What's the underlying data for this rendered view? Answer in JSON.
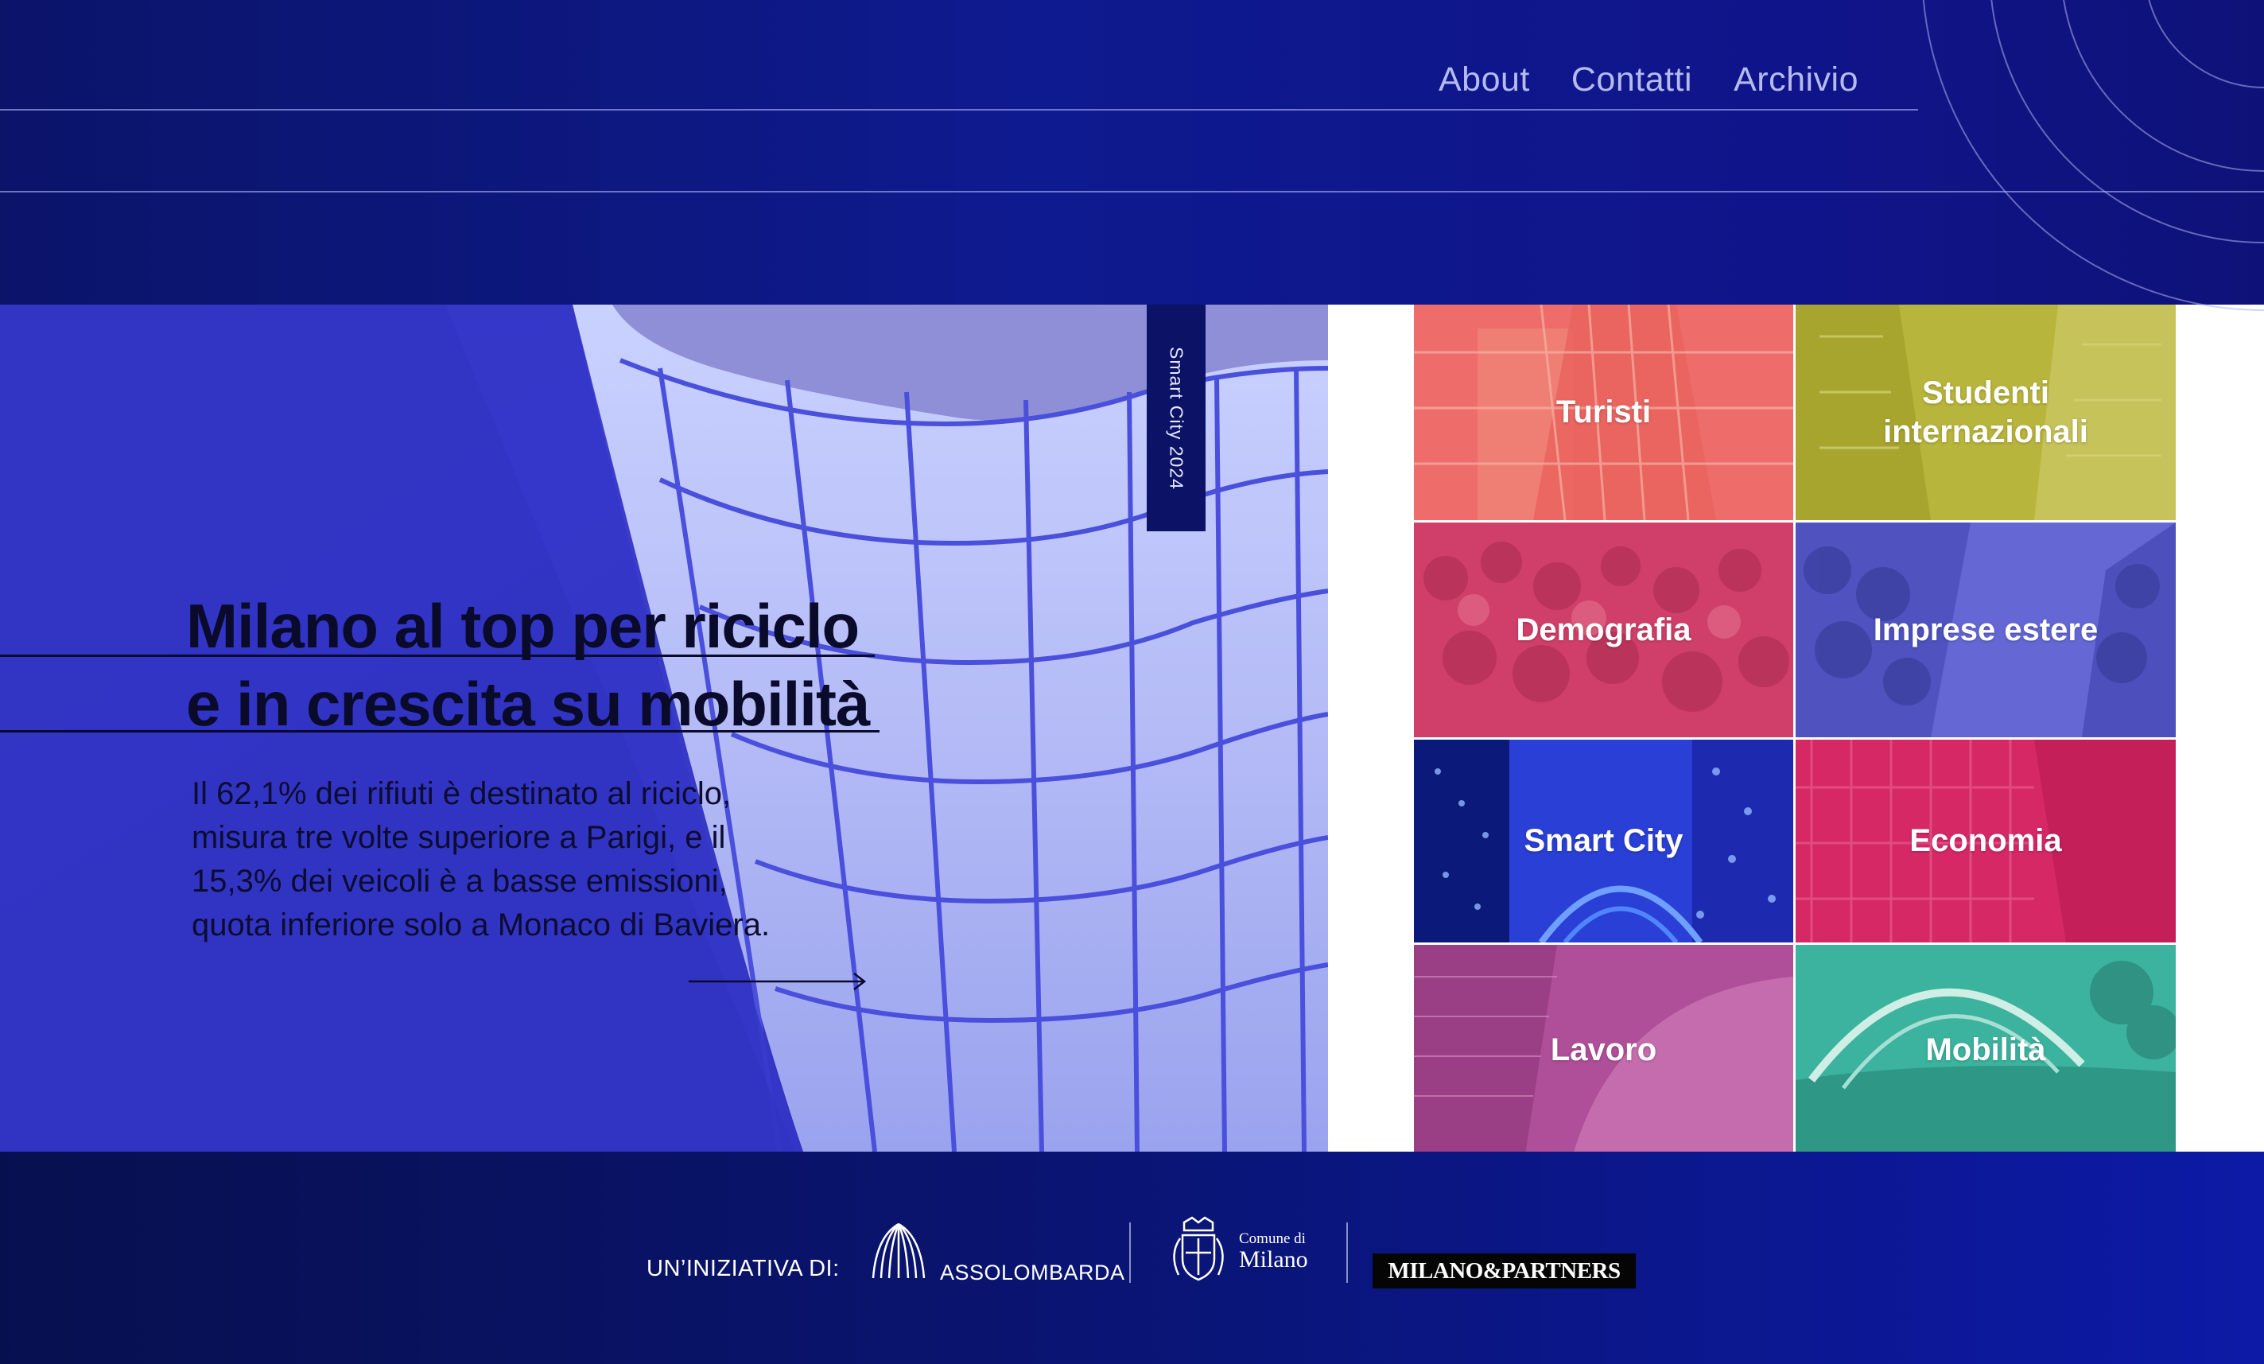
{
  "nav": {
    "items": [
      "About",
      "Contatti",
      "Archivio"
    ]
  },
  "hero": {
    "tag": "Smart City 2024",
    "headline_line1": "Milano al top per riciclo",
    "headline_line2": "e in crescita su mobilità",
    "intro_lines": [
      "Il 62,1% dei rifiuti è destinato al riciclo,",
      "misura tre volte superiore a Parigi, e il",
      "15,3% dei veicoli è a basse emissioni,",
      "quota inferiore solo a Monaco di Baviera."
    ]
  },
  "tiles": [
    {
      "label": "Turisti",
      "color": "#f06f6c"
    },
    {
      "label": "Studenti internazionali",
      "color": "#b9b740"
    },
    {
      "label": "Demografia",
      "color": "#d2436c"
    },
    {
      "label": "Imprese estere",
      "color": "#6669d6"
    },
    {
      "label": "Smart City",
      "color": "#2a3ed0"
    },
    {
      "label": "Economia",
      "color": "#d52a66"
    },
    {
      "label": "Lavoro",
      "color": "#b14f9a"
    },
    {
      "label": "Mobilità",
      "color": "#3bb6a0"
    }
  ],
  "footer": {
    "label": "UN’INIZIATIVA DI:",
    "assolombarda": "ASSOLOMBARDA",
    "comune_line1": "Comune di",
    "comune_line2": "Milano",
    "milano_partners": "MILANO&PARTNERS"
  },
  "colors": {
    "navy": "#0b1469",
    "hero_blue": "#3a3ccd",
    "nav_text": "#b4bbef"
  }
}
